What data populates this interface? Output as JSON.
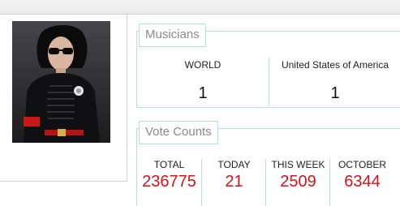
{
  "musicians": {
    "title": "Musicians",
    "columns": [
      {
        "label": "WORLD",
        "value": "1"
      },
      {
        "label": "United States of America",
        "value": "1"
      }
    ]
  },
  "votes": {
    "title": "Vote Counts",
    "columns": [
      {
        "label": "TOTAL",
        "value": "236775"
      },
      {
        "label": "TODAY",
        "value": "21"
      },
      {
        "label": "THIS WEEK",
        "value": "2509"
      },
      {
        "label": "OCTOBER",
        "value": "6344"
      }
    ]
  },
  "colors": {
    "accent_border": "#b9dbe8",
    "vote_value": "#d0141c",
    "legend_text": "#8a8a8a"
  }
}
